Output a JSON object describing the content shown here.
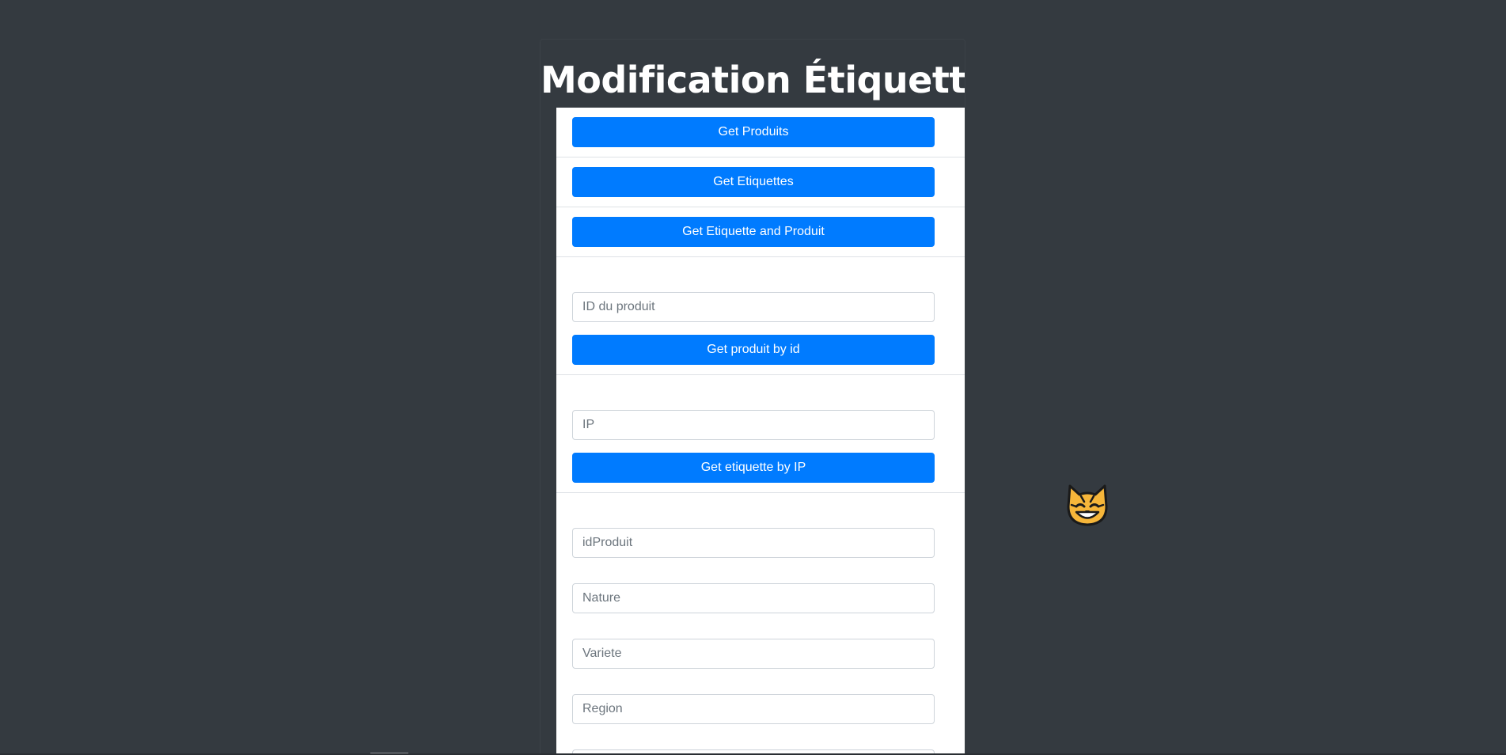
{
  "page": {
    "title": "Modification Étiquettes"
  },
  "buttons": {
    "get_produits": "Get Produits",
    "get_etiquettes": "Get Etiquettes",
    "get_etiquette_and_produit": "Get Etiquette and Produit",
    "get_produit_by_id": "Get produit by id",
    "get_etiquette_by_ip": "Get etiquette by IP"
  },
  "inputs": {
    "id_produit": {
      "placeholder": "ID du produit",
      "value": ""
    },
    "ip": {
      "placeholder": "IP",
      "value": ""
    },
    "form": [
      {
        "placeholder": "idProduit",
        "value": ""
      },
      {
        "placeholder": "Nature",
        "value": ""
      },
      {
        "placeholder": "Variete",
        "value": ""
      },
      {
        "placeholder": "Region",
        "value": ""
      }
    ]
  },
  "icons": {
    "floating": "tiger-face-icon"
  },
  "colors": {
    "background": "#343a40",
    "primary": "#007bff",
    "panel": "#ffffff",
    "tiger": "#f6b63a"
  }
}
